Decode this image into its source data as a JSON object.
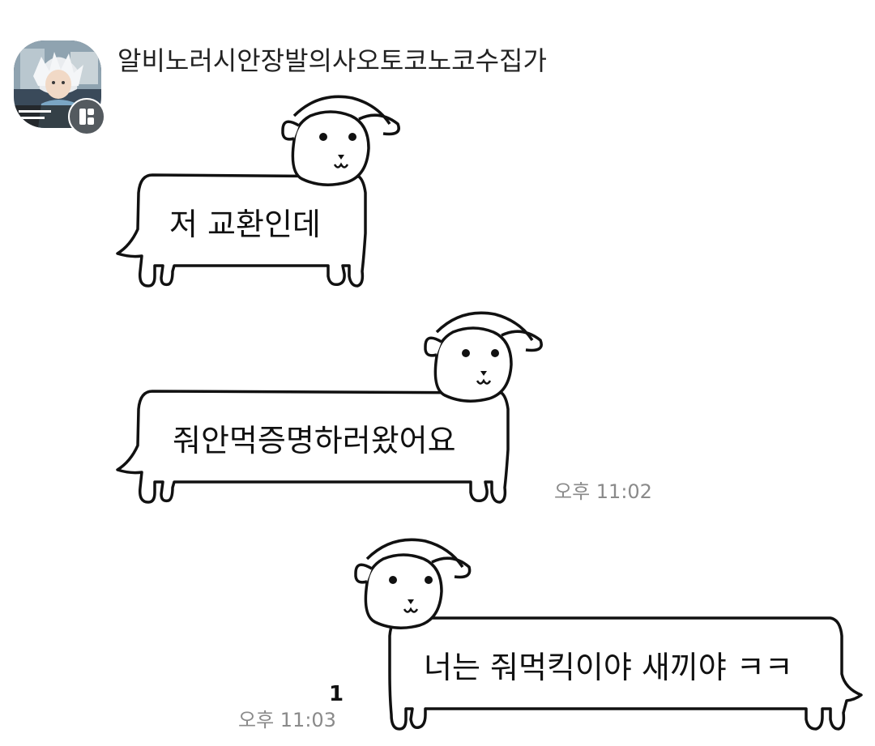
{
  "chat": {
    "sender": {
      "name": "알비노러시안장발의사오토코노코수집가",
      "avatar_icon": "profile-photo",
      "badge_icon": "open-chat-badge-icon"
    },
    "messages": [
      {
        "text": "저 교환인데",
        "direction": "received"
      },
      {
        "text": "줘안먹증명하러왔어요",
        "direction": "received",
        "time": "오후 11:02"
      },
      {
        "text": "너는 줘먹킥이야 새끼야 ㅋㅋ",
        "direction": "sent",
        "time": "오후 11:03",
        "unread_count": "1"
      }
    ],
    "colors": {
      "background": "#ffffff",
      "bubble_fill": "#ffffff",
      "bubble_stroke": "#111111",
      "timestamp": "#8a8a8a"
    }
  }
}
